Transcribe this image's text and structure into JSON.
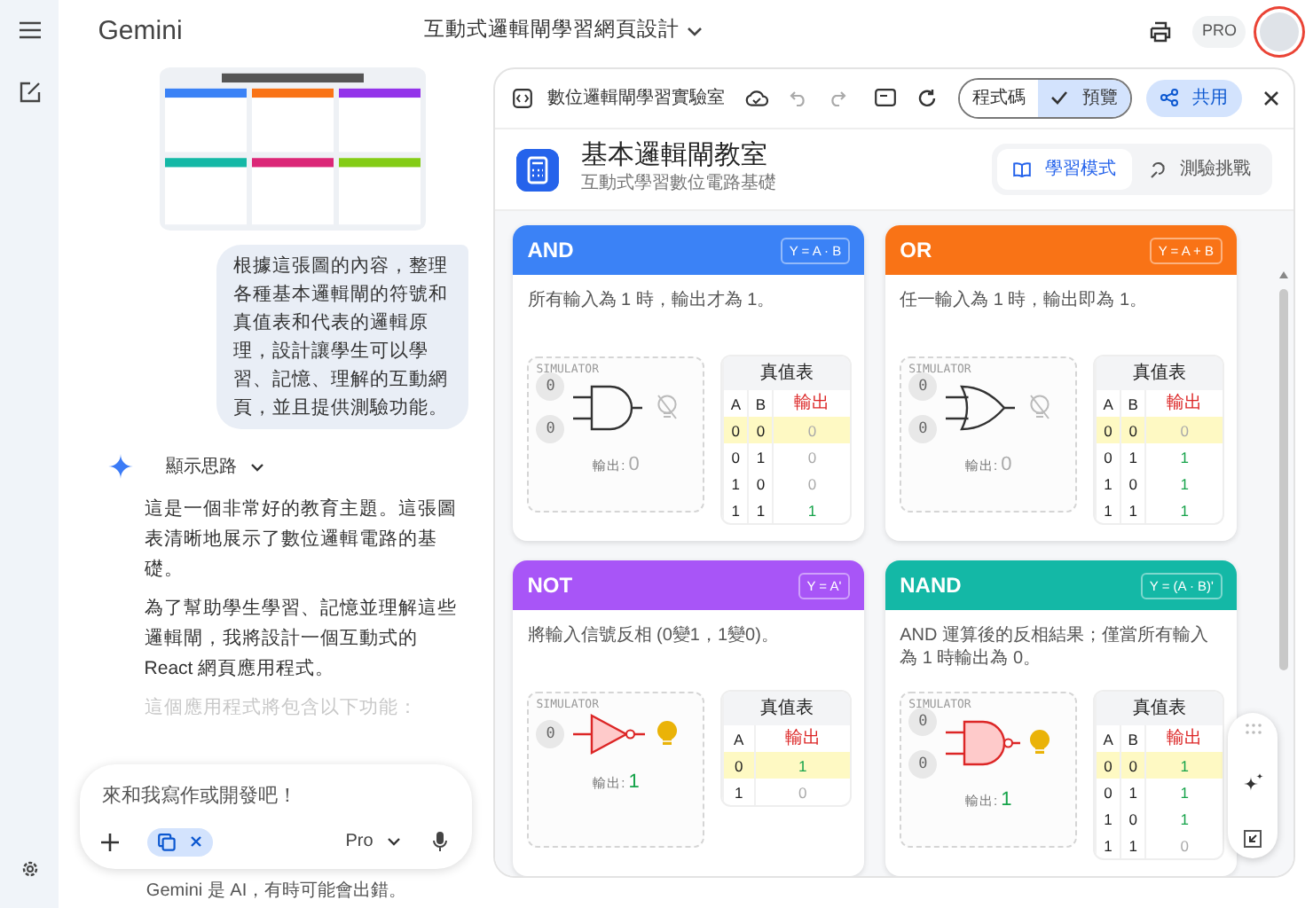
{
  "app": {
    "title": "Gemini"
  },
  "conversation_title": "互動式邏輯閘學習網頁設計",
  "plan_badge": "PRO",
  "chat": {
    "user_message": "根據這張圖的內容，整理各種基本邏輯閘的符號和真值表和代表的邏輯原理，設計讓學生可以學習、記憶、理解的互動網頁，並且提供測驗功能。",
    "thoughts_toggle": "顯示思路",
    "response_paragraphs": [
      {
        "text": "這是一個非常好的教育主題。這張圖表清晰地展示了數位邏輯電路的基礎。",
        "faded": false
      },
      {
        "text": "為了幫助學生學習、記憶並理解這些邏輯閘，我將設計一個互動式的 React 網頁應用程式。",
        "faded": false
      },
      {
        "text": "這個應用程式將包含以下功能：",
        "faded": true
      }
    ],
    "input": {
      "placeholder": "來和我寫作或開發吧！"
    },
    "model": "Pro",
    "disclaimer": "Gemini 是 AI，有時可能會出錯。"
  },
  "canvas": {
    "title": "數位邏輯閘學習實驗室",
    "view_toggle": [
      {
        "label": "程式碼",
        "selected": false
      },
      {
        "label": "預覽",
        "selected": true
      }
    ],
    "share": "共用",
    "app": {
      "title": "基本邏輯閘教室",
      "subtitle": "互動式學習數位電路基礎",
      "modes": [
        {
          "label": "學習模式",
          "selected": true
        },
        {
          "label": "測驗挑戰",
          "selected": false
        }
      ],
      "gates": [
        {
          "name": "AND",
          "color": "#3b82f6",
          "formula": "Y = A · B",
          "description": "所有輸入為 1 時，輸出才為 1。",
          "sim_label": "SIMULATOR",
          "kind": "and",
          "inputs": [
            "0",
            "0"
          ],
          "lamp_on": false,
          "output_label": "輸出:",
          "output": "0",
          "table": {
            "title": "真值表",
            "columns": [
              "A",
              "B",
              "輸出"
            ],
            "rows": [
              {
                "cells": [
                  "0",
                  "0",
                  "0"
                ],
                "selected": true,
                "high": false
              },
              {
                "cells": [
                  "0",
                  "1",
                  "0"
                ],
                "selected": false,
                "high": false
              },
              {
                "cells": [
                  "1",
                  "0",
                  "0"
                ],
                "selected": false,
                "high": false
              },
              {
                "cells": [
                  "1",
                  "1",
                  "1"
                ],
                "selected": false,
                "high": true
              }
            ]
          }
        },
        {
          "name": "OR",
          "color": "#f97316",
          "formula": "Y = A + B",
          "description": "任一輸入為 1 時，輸出即為 1。",
          "sim_label": "SIMULATOR",
          "kind": "or",
          "inputs": [
            "0",
            "0"
          ],
          "lamp_on": false,
          "output_label": "輸出:",
          "output": "0",
          "table": {
            "title": "真值表",
            "columns": [
              "A",
              "B",
              "輸出"
            ],
            "rows": [
              {
                "cells": [
                  "0",
                  "0",
                  "0"
                ],
                "selected": true,
                "high": false
              },
              {
                "cells": [
                  "0",
                  "1",
                  "1"
                ],
                "selected": false,
                "high": true
              },
              {
                "cells": [
                  "1",
                  "0",
                  "1"
                ],
                "selected": false,
                "high": true
              },
              {
                "cells": [
                  "1",
                  "1",
                  "1"
                ],
                "selected": false,
                "high": true
              }
            ]
          }
        },
        {
          "name": "NOT",
          "color": "#a855f7",
          "formula": "Y = A'",
          "description": "將輸入信號反相 (0變1，1變0)。",
          "sim_label": "SIMULATOR",
          "kind": "not",
          "inputs": [
            "0"
          ],
          "lamp_on": true,
          "output_label": "輸出:",
          "output": "1",
          "table": {
            "title": "真值表",
            "columns": [
              "A",
              "輸出"
            ],
            "rows": [
              {
                "cells": [
                  "0",
                  "1"
                ],
                "selected": true,
                "high": true
              },
              {
                "cells": [
                  "1",
                  "0"
                ],
                "selected": false,
                "high": false
              }
            ]
          }
        },
        {
          "name": "NAND",
          "color": "#14b8a6",
          "formula": "Y = (A · B)'",
          "description": "AND 運算後的反相結果；僅當所有輸入為 1 時輸出為 0。",
          "sim_label": "SIMULATOR",
          "kind": "nand",
          "inputs": [
            "0",
            "0"
          ],
          "lamp_on": true,
          "output_label": "輸出:",
          "output": "1",
          "table": {
            "title": "真值表",
            "columns": [
              "A",
              "B",
              "輸出"
            ],
            "rows": [
              {
                "cells": [
                  "0",
                  "0",
                  "1"
                ],
                "selected": true,
                "high": true
              },
              {
                "cells": [
                  "0",
                  "1",
                  "1"
                ],
                "selected": false,
                "high": true
              },
              {
                "cells": [
                  "1",
                  "0",
                  "1"
                ],
                "selected": false,
                "high": true
              },
              {
                "cells": [
                  "1",
                  "1",
                  "0"
                ],
                "selected": false,
                "high": false
              }
            ]
          }
        }
      ]
    }
  }
}
